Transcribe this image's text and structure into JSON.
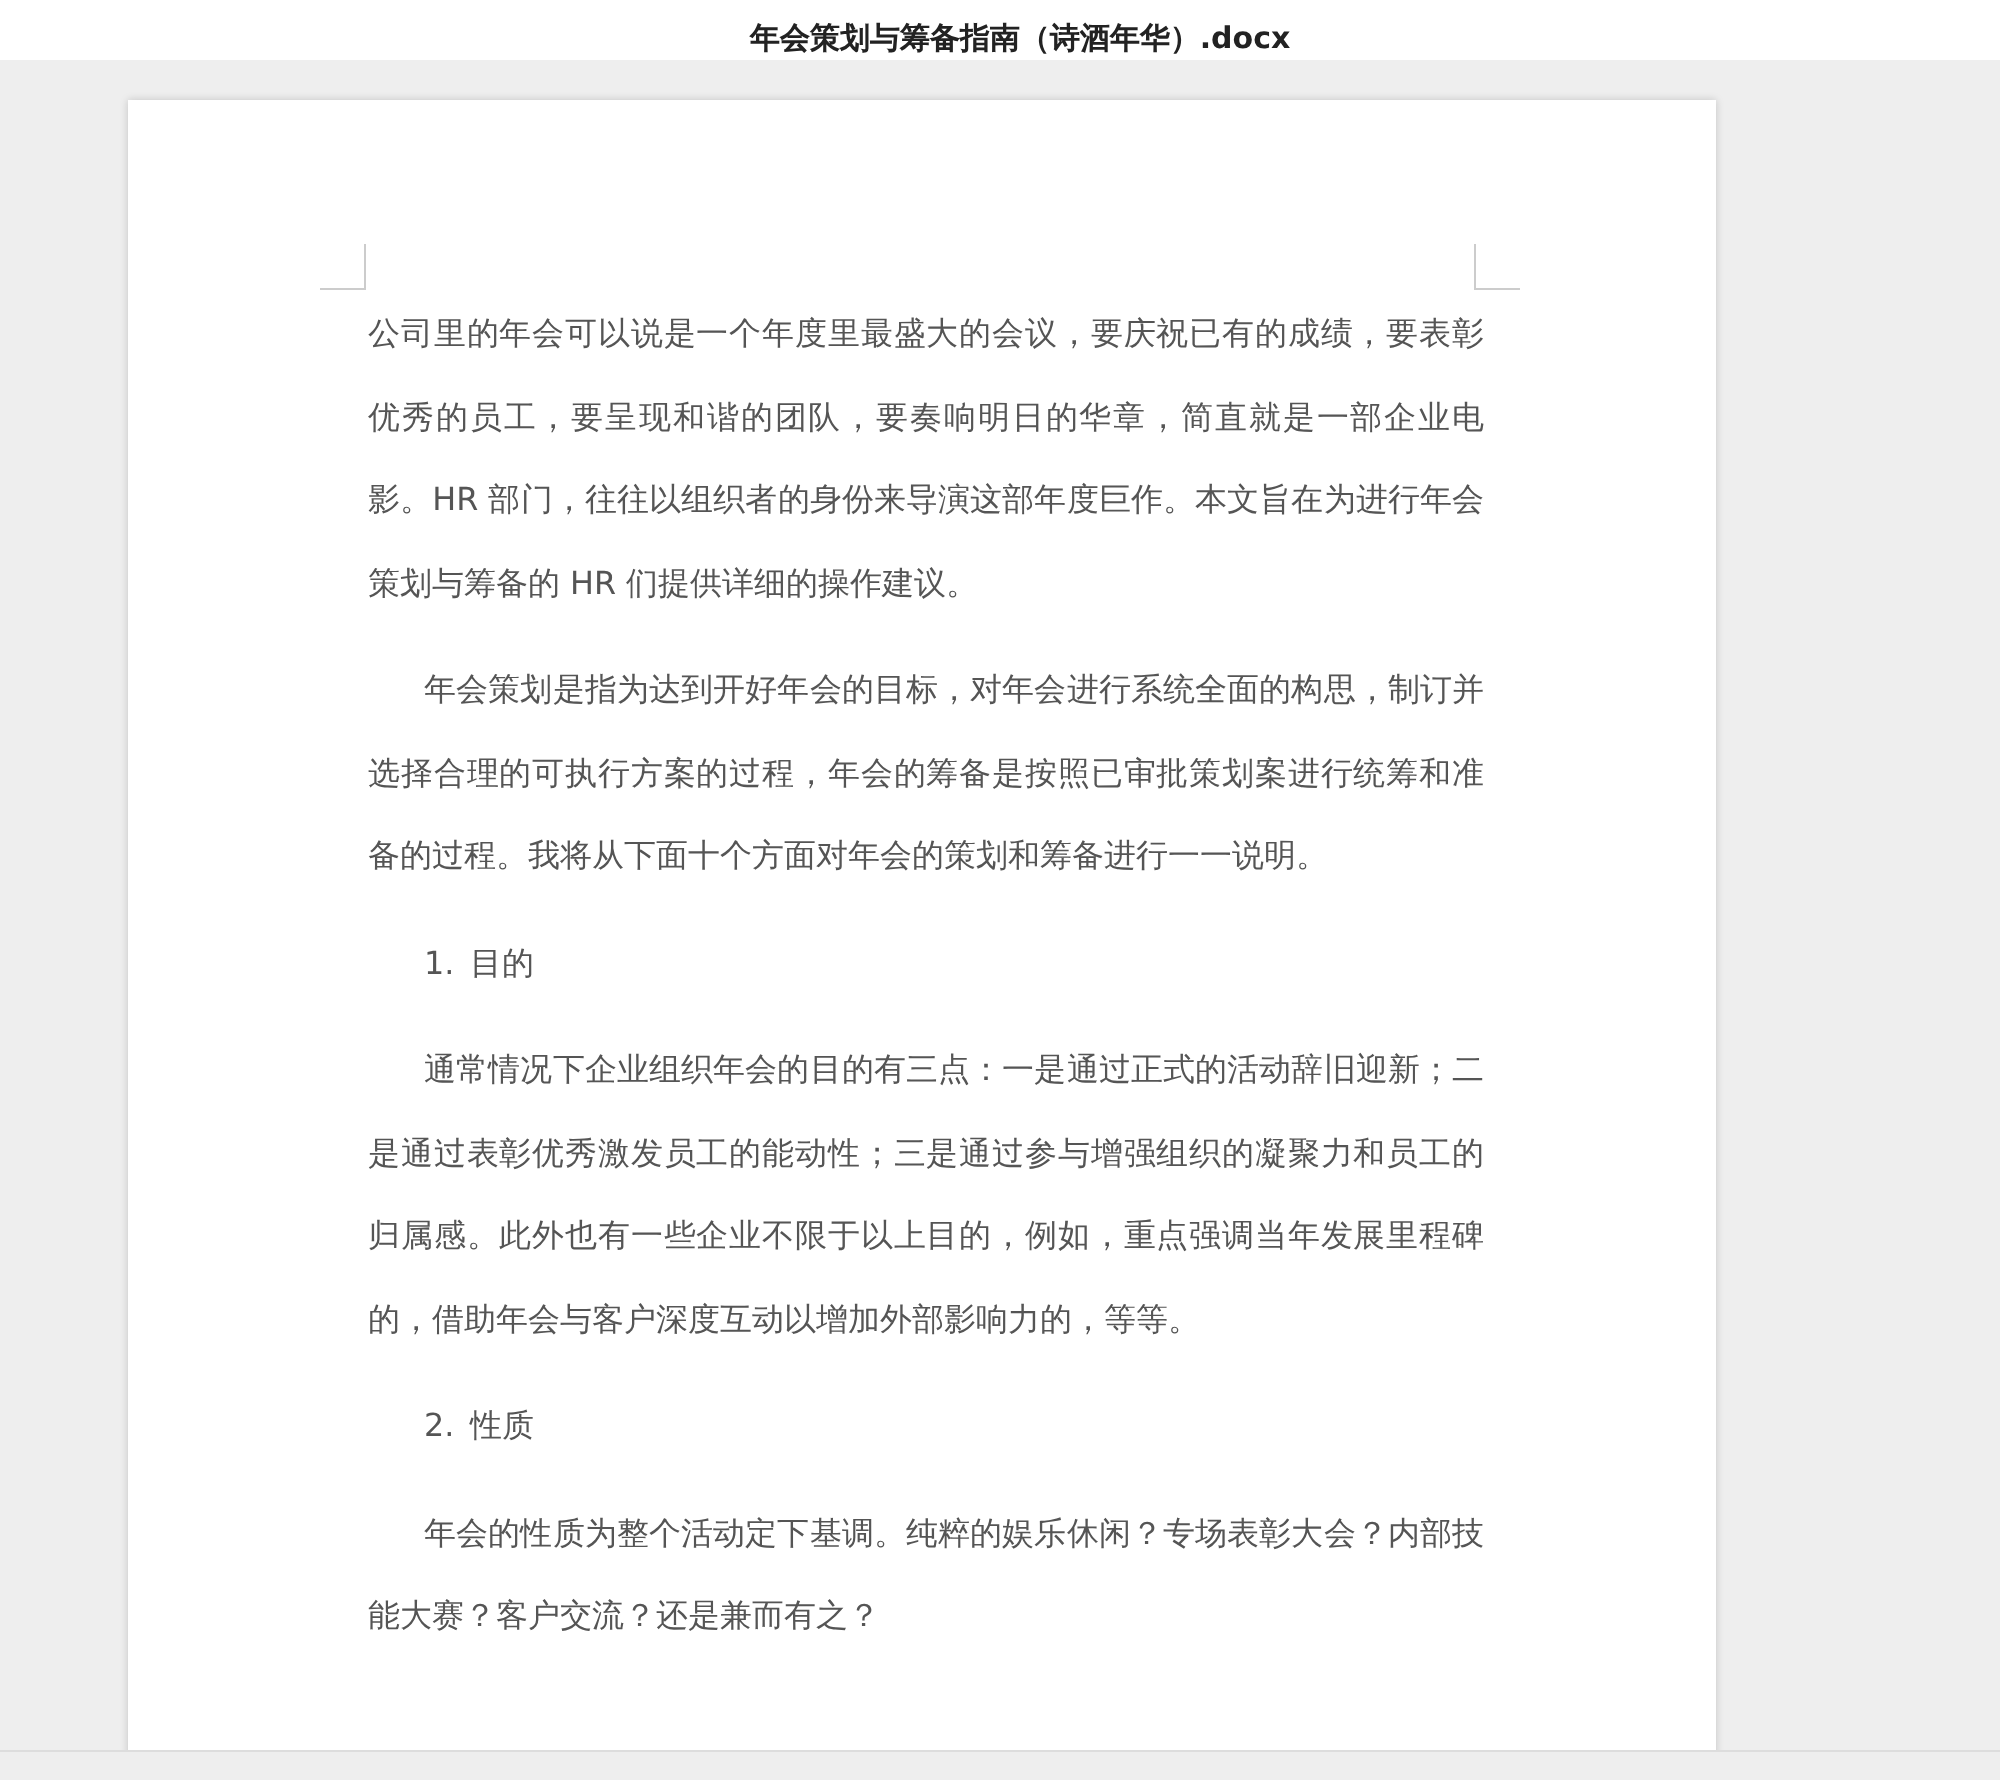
{
  "window": {
    "title": "年会策划与筹备指南（诗酒年华）.docx"
  },
  "document": {
    "blocks": [
      {
        "kind": "paragraph",
        "indent": false,
        "text": "公司里的年会可以说是一个年度里最盛大的会议，要庆祝已有的成绩，要表彰优秀的员工，要呈现和谐的团队，要奏响明日的华章，简直就是一部企业电影。HR 部门，往往以组织者的身份来导演这部年度巨作。本文旨在为进行年会策划与筹备的 HR 们提供详细的操作建议。"
      },
      {
        "kind": "paragraph",
        "indent": true,
        "text": "年会策划是指为达到开好年会的目标，对年会进行系统全面的构思，制订并选择合理的可执行方案的过程，年会的筹备是按照已审批策划案进行统筹和准备的过程。我将从下面十个方面对年会的策划和筹备进行一一说明。"
      },
      {
        "kind": "list_item",
        "number": "1.",
        "text": "目的"
      },
      {
        "kind": "paragraph",
        "indent": true,
        "text": "通常情况下企业组织年会的目的有三点：一是通过正式的活动辞旧迎新；二是通过表彰优秀激发员工的能动性；三是通过参与增强组织的凝聚力和员工的归属感。此外也有一些企业不限于以上目的，例如，重点强调当年发展里程碑的，借助年会与客户深度互动以增加外部影响力的，等等。"
      },
      {
        "kind": "list_item",
        "number": "2.",
        "text": "性质"
      },
      {
        "kind": "paragraph",
        "indent": true,
        "text": "年会的性质为整个活动定下基调。纯粹的娱乐休闲？专场表彰大会？内部技能大赛？客户交流？还是兼而有之？"
      }
    ]
  }
}
